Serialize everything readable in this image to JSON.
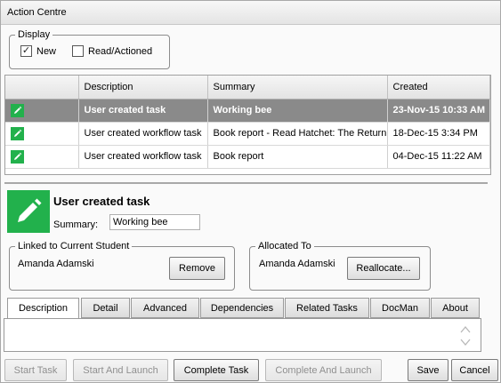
{
  "window": {
    "title": "Action Centre"
  },
  "display": {
    "legend": "Display",
    "new_label": "New",
    "new_checked": true,
    "read_label": "Read/Actioned",
    "read_checked": false
  },
  "grid": {
    "headers": [
      "",
      "Description",
      "Summary",
      "Created"
    ],
    "rows": [
      {
        "description": "User created task",
        "summary": "Working bee",
        "created": "23-Nov-15 10:33 AM",
        "selected": true
      },
      {
        "description": "User created workflow task",
        "summary": "Book report - Read Hatchet: The Return",
        "created": "18-Dec-15 3:34 PM",
        "selected": false
      },
      {
        "description": "User created workflow task",
        "summary": "Book report",
        "created": "04-Dec-15 11:22 AM",
        "selected": false
      }
    ]
  },
  "detail": {
    "title": "User created task",
    "summary_label": "Summary:",
    "summary_value": "Working bee"
  },
  "linked": {
    "legend": "Linked to Current Student",
    "name": "Amanda Adamski",
    "button": "Remove"
  },
  "allocated": {
    "legend": "Allocated To",
    "name": "Amanda Adamski",
    "button": "Reallocate..."
  },
  "tabs": [
    "Description",
    "Detail",
    "Advanced",
    "Dependencies",
    "Related Tasks",
    "DocMan",
    "About"
  ],
  "buttons": {
    "start_task": "Start Task",
    "start_launch": "Start And Launch",
    "complete_task": "Complete Task",
    "complete_launch": "Complete And Launch",
    "save": "Save",
    "cancel": "Cancel"
  },
  "colors": {
    "task_green": "#22b14c",
    "selected_row": "#8a8a8a"
  }
}
